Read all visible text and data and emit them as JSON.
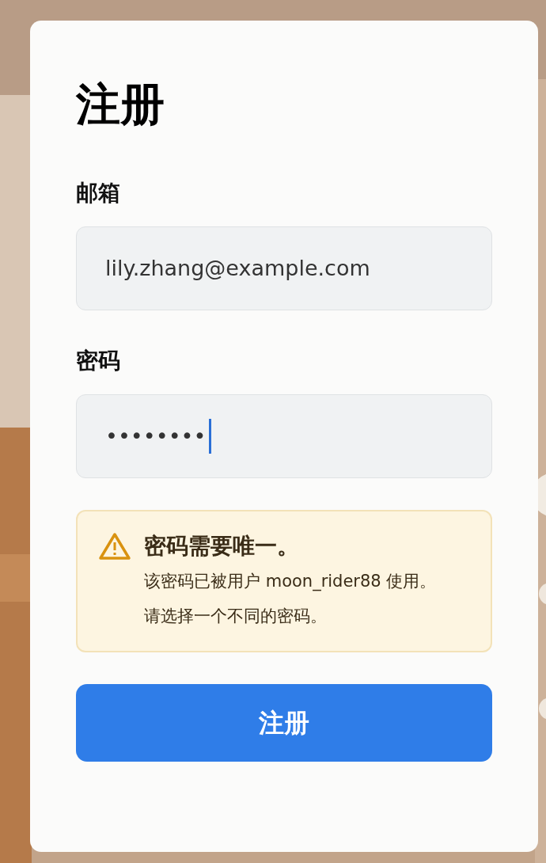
{
  "title": "注册",
  "fields": [
    {
      "label": "邮箱",
      "value": "lily.zhang@example.com",
      "focused": false
    },
    {
      "label": "密码",
      "value": "••••••••",
      "focused": true
    }
  ],
  "alert": {
    "kind": "warning",
    "title": "密码需要唯一。",
    "lines": [
      "该密码已被用户 moon_rider88 使用。",
      "请选择一个不同的密码。"
    ]
  },
  "button": "注册"
}
